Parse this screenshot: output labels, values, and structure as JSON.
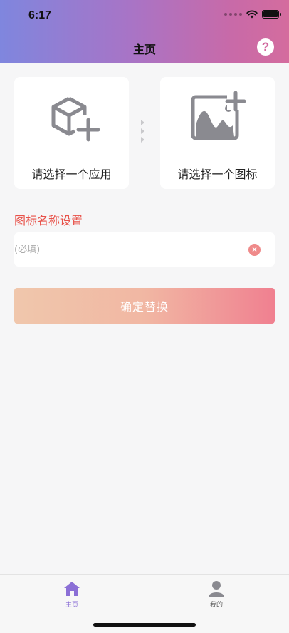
{
  "status_bar": {
    "time": "6:17"
  },
  "header": {
    "title": "主页",
    "help_icon": "question-circle-icon"
  },
  "cards": [
    {
      "label": "请选择一个应用",
      "icon": "box-plus-icon"
    },
    {
      "label": "请选择一个图标",
      "icon": "image-plus-icon"
    }
  ],
  "form": {
    "section_title": "图标名称设置",
    "name_input": {
      "value": "",
      "placeholder": "(必填)"
    },
    "confirm_label": "确定替换"
  },
  "tabbar": {
    "items": [
      {
        "label": "主页",
        "icon": "home-icon",
        "active": true
      },
      {
        "label": "我的",
        "icon": "user-icon",
        "active": false
      }
    ]
  },
  "colors": {
    "accent": "#8b6fd6",
    "section_title": "#e8524a",
    "button_start": "#f0c7ac",
    "button_end": "#f08090"
  }
}
